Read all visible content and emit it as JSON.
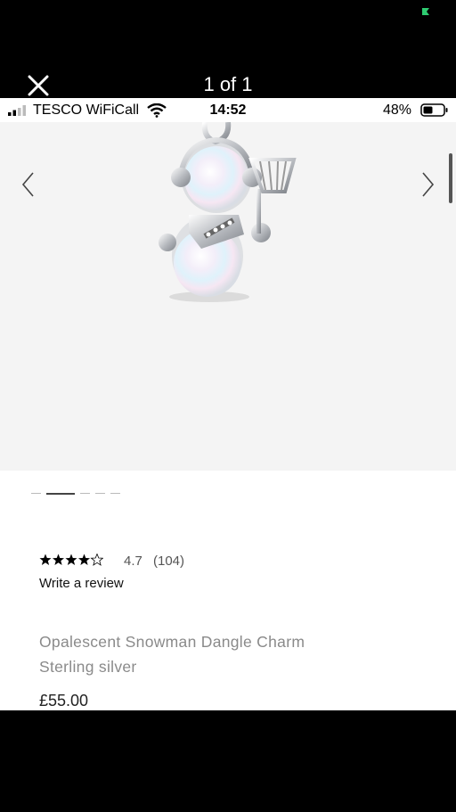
{
  "viewer": {
    "counter": "1 of 1"
  },
  "status_bar": {
    "carrier": "TESCO WiFiCall",
    "time": "14:52",
    "battery_percent": "48%",
    "icons": [
      "signal-icon",
      "wifi-icon",
      "battery-icon"
    ]
  },
  "gallery": {
    "image_alt": "Opalescent snowman dangle charm",
    "total_images": 5,
    "active_index": 2
  },
  "product": {
    "rating_value": 4.7,
    "rating": "4.7",
    "review_count": "(104)",
    "write_review": "Write a review",
    "title": "Opalescent Snowman Dangle Charm",
    "material": "Sterling silver",
    "price": "£55.00"
  },
  "colors": {
    "background": "#000000",
    "page": "#ffffff",
    "gallery_bg": "#f4f4f4",
    "muted_text": "#8a8a8a",
    "accent_dot": "#2ecc71"
  }
}
